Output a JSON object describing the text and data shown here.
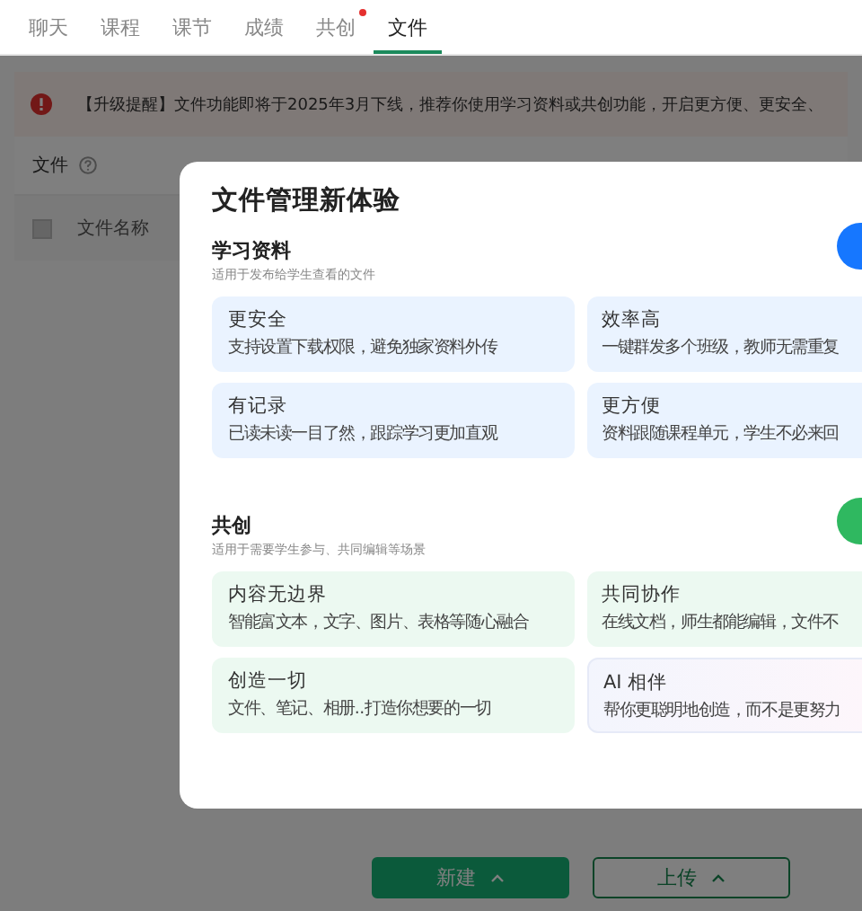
{
  "tabs": [
    {
      "label": "聊天",
      "selected": false,
      "badge": false
    },
    {
      "label": "课程",
      "selected": false,
      "badge": false
    },
    {
      "label": "课节",
      "selected": false,
      "badge": false
    },
    {
      "label": "成绩",
      "selected": false,
      "badge": false
    },
    {
      "label": "共创",
      "selected": false,
      "badge": true
    },
    {
      "label": "文件",
      "selected": true,
      "badge": false
    }
  ],
  "banner": {
    "text": "【升级提醒】文件功能即将于2025年3月下线，推荐你使用学习资料或共创功能，开启更方便、更安全、"
  },
  "file_list": {
    "title": "文件",
    "columns": [
      "文件名称"
    ],
    "select_all_checked": false
  },
  "footer_buttons": [
    {
      "label": "新建",
      "kind": "primary"
    },
    {
      "label": "上传",
      "kind": "outline"
    }
  ],
  "dialog": {
    "title": "文件管理新体验",
    "sections": [
      {
        "title": "学习资料",
        "subtitle": "适用于发布给学生查看的文件",
        "color": "#1677ff",
        "cards": [
          {
            "title": "更安全",
            "text": "支持设置下载权限，避免独家资料外传",
            "kind": "plain"
          },
          {
            "title": "效率高",
            "text": "一键群发多个班级，教师无需重复",
            "kind": "plain"
          },
          {
            "title": "有记录",
            "text": "已读未读一目了然，跟踪学习更加直观",
            "kind": "plain"
          },
          {
            "title": "更方便",
            "text": "资料跟随课程单元，学生不必来回",
            "kind": "plain"
          }
        ]
      },
      {
        "title": "共创",
        "subtitle": "适用于需要学生参与、共同编辑等场景",
        "color": "#2fb860",
        "cards": [
          {
            "title": "内容无边界",
            "text": "智能富文本，文字、图片、表格等随心融合",
            "kind": "plain"
          },
          {
            "title": "共同协作",
            "text": "在线文档，师生都能编辑，文件不",
            "kind": "plain"
          },
          {
            "title": "创造一切",
            "text": "文件、笔记、相册..打造你想要的一切",
            "kind": "plain"
          },
          {
            "title": "AI 相伴",
            "text": "帮你更聪明地创造，而不是更努力",
            "kind": "ai"
          }
        ]
      }
    ]
  }
}
